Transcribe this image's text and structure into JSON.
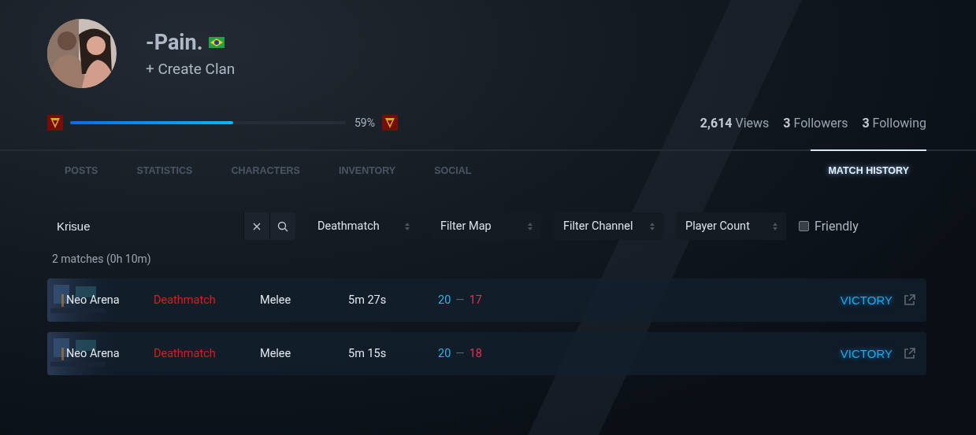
{
  "profile": {
    "name": "-Pain.",
    "clan_action": "+ Create Clan",
    "level": 0.59,
    "level_reading": "59%"
  },
  "stats": [
    {
      "count": "2,614",
      "label": "Views"
    },
    {
      "count": "3",
      "label": "Followers"
    },
    {
      "count": "3",
      "label": "Following"
    }
  ],
  "tabs": [
    {
      "label": "POSTS",
      "selected": false
    },
    {
      "label": "STATISTICS",
      "selected": false
    },
    {
      "label": "CHARACTERS",
      "selected": false
    },
    {
      "label": "INVENTORY",
      "selected": false
    },
    {
      "label": "SOCIAL",
      "selected": false
    },
    {
      "label": "MATCH HISTORY",
      "selected": true
    }
  ],
  "filters": {
    "search": {
      "value": "Krisue"
    },
    "selects": [
      {
        "label": "Deathmatch"
      },
      {
        "label": "Filter Map"
      },
      {
        "label": "Filter Channel"
      },
      {
        "label": "Player Count"
      }
    ],
    "friendly": {
      "label": "Friendly",
      "checked": false
    }
  },
  "summary": "2 matches (0h 10m)",
  "matches": [
    {
      "map": "Neo Arena",
      "mode": "Deathmatch",
      "weapon": "Melee",
      "duration": "5m 27s",
      "score_a": "20",
      "separator": "—",
      "score_b": "17",
      "result": "VICTORY"
    },
    {
      "map": "Neo Arena",
      "mode": "Deathmatch",
      "weapon": "Melee",
      "duration": "5m 15s",
      "score_a": "20",
      "separator": "—",
      "score_b": "18",
      "result": "VICTORY"
    }
  ]
}
